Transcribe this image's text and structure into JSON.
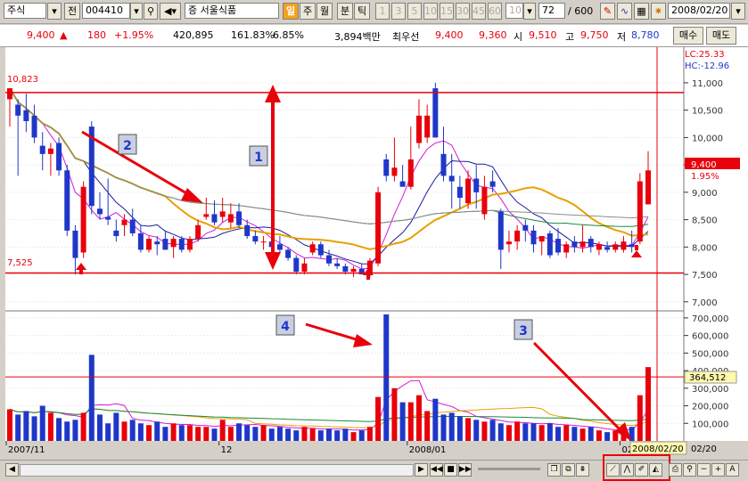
{
  "toolbar": {
    "market": "주식",
    "tab_prev": "전",
    "code": "004410",
    "stock_prefix": "증",
    "stock_name": "서울식품",
    "periods": [
      "일",
      "주",
      "월",
      "분",
      "틱"
    ],
    "minutes": [
      "1",
      "3",
      "5",
      "10",
      "15",
      "30",
      "45",
      "60"
    ],
    "minute_select": "10",
    "count": "72",
    "total": "/ 600",
    "date": "2008/02/20"
  },
  "quote": {
    "price": "9,400",
    "change": "180",
    "change_pct": "+1.95%",
    "volume": "420,895",
    "vol_ratio": "161.83%",
    "turnover": "6.85%",
    "amount": "3,894백만",
    "best_label": "최우선",
    "best_ask": "9,400",
    "best_bid": "9,360",
    "open_label": "시",
    "open": "9,510",
    "high_label": "고",
    "high": "9,750",
    "low_label": "저",
    "low": "8,780",
    "buy_label": "매수",
    "sell_label": "매도"
  },
  "labels": {
    "lc": "LC:25.33",
    "hc": "HC:-12.96",
    "high_line": "10,823",
    "low_line": "7,525",
    "last_price": "9,400",
    "last_pct": "1.95%",
    "vol_current": "364,512",
    "cursor_date": "2008/02/20",
    "x_end": "02/20"
  },
  "annotations": [
    "1",
    "2",
    "3",
    "4"
  ],
  "colors": {
    "up": "#e8000b",
    "down": "#1f37c8",
    "ma5": "#d21adc",
    "ma10": "#1a1aa0",
    "ma20": "#e8a000",
    "ma60": "#1b8a3a",
    "ma120": "#8c8c8c"
  },
  "chart_data": {
    "type": "candlestick",
    "price_axis": {
      "min": 7000,
      "max": 11000,
      "ticks": [
        7000,
        7500,
        8000,
        8500,
        9000,
        9500,
        10000,
        10500,
        11000
      ]
    },
    "volume_axis": {
      "min": 0,
      "max": 700000,
      "ticks": [
        100000,
        200000,
        300000,
        400000,
        500000,
        600000,
        700000
      ]
    },
    "x_ticks": [
      {
        "index": 0,
        "label": "2007/11"
      },
      {
        "index": 26,
        "label": "12"
      },
      {
        "index": 49,
        "label": "2008/01"
      },
      {
        "index": 75,
        "label": "02"
      }
    ],
    "reference_lines": [
      10823,
      7525
    ],
    "volume_reference": 364512,
    "candles": [
      {
        "o": 10700,
        "h": 10900,
        "l": 10200,
        "c": 10900
      },
      {
        "o": 10600,
        "h": 10700,
        "l": 9300,
        "c": 10400
      },
      {
        "o": 10500,
        "h": 10800,
        "l": 10100,
        "c": 10300
      },
      {
        "o": 10400,
        "h": 10600,
        "l": 9900,
        "c": 10000
      },
      {
        "o": 9850,
        "h": 10100,
        "l": 9400,
        "c": 9700
      },
      {
        "o": 9700,
        "h": 9900,
        "l": 9300,
        "c": 9800
      },
      {
        "o": 9900,
        "h": 10000,
        "l": 9300,
        "c": 9400
      },
      {
        "o": 9400,
        "h": 9500,
        "l": 8200,
        "c": 8300
      },
      {
        "o": 8300,
        "h": 8400,
        "l": 7500,
        "c": 7800
      },
      {
        "o": 7900,
        "h": 9200,
        "l": 7800,
        "c": 9100
      },
      {
        "o": 10200,
        "h": 10300,
        "l": 8600,
        "c": 8750
      },
      {
        "o": 8700,
        "h": 9000,
        "l": 8500,
        "c": 8600
      },
      {
        "o": 8550,
        "h": 9250,
        "l": 8400,
        "c": 8500
      },
      {
        "o": 8300,
        "h": 8500,
        "l": 8100,
        "c": 8200
      },
      {
        "o": 8400,
        "h": 8600,
        "l": 8200,
        "c": 8500
      },
      {
        "o": 8500,
        "h": 8700,
        "l": 8200,
        "c": 8250
      },
      {
        "o": 8250,
        "h": 8400,
        "l": 7900,
        "c": 7950
      },
      {
        "o": 7950,
        "h": 8200,
        "l": 7900,
        "c": 8150
      },
      {
        "o": 8100,
        "h": 8200,
        "l": 7850,
        "c": 8050
      },
      {
        "o": 8150,
        "h": 8300,
        "l": 7950,
        "c": 7950
      },
      {
        "o": 8000,
        "h": 8200,
        "l": 7800,
        "c": 8150
      },
      {
        "o": 8150,
        "h": 8200,
        "l": 7900,
        "c": 7950
      },
      {
        "o": 7950,
        "h": 8200,
        "l": 7900,
        "c": 8150
      },
      {
        "o": 8150,
        "h": 8500,
        "l": 8100,
        "c": 8400
      },
      {
        "o": 8550,
        "h": 8900,
        "l": 8500,
        "c": 8600
      },
      {
        "o": 8600,
        "h": 8850,
        "l": 8400,
        "c": 8450
      },
      {
        "o": 8550,
        "h": 8900,
        "l": 8450,
        "c": 8650
      },
      {
        "o": 8450,
        "h": 8800,
        "l": 8350,
        "c": 8600
      },
      {
        "o": 8650,
        "h": 8800,
        "l": 8350,
        "c": 8400
      },
      {
        "o": 8400,
        "h": 8500,
        "l": 8150,
        "c": 8200
      },
      {
        "o": 8200,
        "h": 8300,
        "l": 8050,
        "c": 8100
      },
      {
        "o": 8100,
        "h": 8200,
        "l": 7950,
        "c": 8100
      },
      {
        "o": 8100,
        "h": 8150,
        "l": 7850,
        "c": 8000
      },
      {
        "o": 8050,
        "h": 8200,
        "l": 7900,
        "c": 7950
      },
      {
        "o": 7950,
        "h": 8000,
        "l": 7750,
        "c": 7800
      },
      {
        "o": 7800,
        "h": 7850,
        "l": 7500,
        "c": 7550
      },
      {
        "o": 7550,
        "h": 7800,
        "l": 7500,
        "c": 7700
      },
      {
        "o": 7900,
        "h": 8100,
        "l": 7850,
        "c": 8050
      },
      {
        "o": 8050,
        "h": 8100,
        "l": 7800,
        "c": 7850
      },
      {
        "o": 7850,
        "h": 7950,
        "l": 7650,
        "c": 7700
      },
      {
        "o": 7700,
        "h": 7800,
        "l": 7600,
        "c": 7650
      },
      {
        "o": 7650,
        "h": 7700,
        "l": 7500,
        "c": 7550
      },
      {
        "o": 7550,
        "h": 7650,
        "l": 7450,
        "c": 7600
      },
      {
        "o": 7600,
        "h": 7700,
        "l": 7500,
        "c": 7500
      },
      {
        "o": 7500,
        "h": 7800,
        "l": 7450,
        "c": 7750
      },
      {
        "o": 7700,
        "h": 9100,
        "l": 7650,
        "c": 9000
      },
      {
        "o": 9600,
        "h": 9700,
        "l": 9200,
        "c": 9300
      },
      {
        "o": 9300,
        "h": 10000,
        "l": 9200,
        "c": 9450
      },
      {
        "o": 9200,
        "h": 9500,
        "l": 9150,
        "c": 9100
      },
      {
        "o": 9100,
        "h": 10200,
        "l": 9050,
        "c": 9600
      },
      {
        "o": 9900,
        "h": 10700,
        "l": 9800,
        "c": 10400
      },
      {
        "o": 10000,
        "h": 10600,
        "l": 9900,
        "c": 10400
      },
      {
        "o": 10900,
        "h": 11000,
        "l": 10000,
        "c": 10000
      },
      {
        "o": 9700,
        "h": 10200,
        "l": 9200,
        "c": 9300
      },
      {
        "o": 9300,
        "h": 9700,
        "l": 8700,
        "c": 9200
      },
      {
        "o": 9100,
        "h": 9300,
        "l": 8700,
        "c": 8900
      },
      {
        "o": 8800,
        "h": 9400,
        "l": 8700,
        "c": 9250
      },
      {
        "o": 9250,
        "h": 9500,
        "l": 8700,
        "c": 9000
      },
      {
        "o": 8600,
        "h": 9300,
        "l": 8500,
        "c": 9100
      },
      {
        "o": 9200,
        "h": 9400,
        "l": 9000,
        "c": 9100
      },
      {
        "o": 8650,
        "h": 8700,
        "l": 7600,
        "c": 7950
      },
      {
        "o": 8050,
        "h": 8300,
        "l": 7900,
        "c": 8100
      },
      {
        "o": 8100,
        "h": 8400,
        "l": 7950,
        "c": 8300
      },
      {
        "o": 8400,
        "h": 8500,
        "l": 8100,
        "c": 8300
      },
      {
        "o": 8300,
        "h": 8400,
        "l": 7900,
        "c": 8050
      },
      {
        "o": 8100,
        "h": 8200,
        "l": 7850,
        "c": 8200
      },
      {
        "o": 8250,
        "h": 8300,
        "l": 7800,
        "c": 7850
      },
      {
        "o": 8150,
        "h": 8350,
        "l": 7850,
        "c": 7900
      },
      {
        "o": 7900,
        "h": 8100,
        "l": 7800,
        "c": 8050
      },
      {
        "o": 8100,
        "h": 8200,
        "l": 7900,
        "c": 8000
      },
      {
        "o": 8000,
        "h": 8400,
        "l": 7900,
        "c": 8100
      },
      {
        "o": 8150,
        "h": 8200,
        "l": 7900,
        "c": 8000
      },
      {
        "o": 7950,
        "h": 8100,
        "l": 7850,
        "c": 8050
      },
      {
        "o": 8000,
        "h": 8100,
        "l": 7900,
        "c": 7950
      },
      {
        "o": 7950,
        "h": 8100,
        "l": 7900,
        "c": 8050
      },
      {
        "o": 7950,
        "h": 8200,
        "l": 7900,
        "c": 8100
      },
      {
        "o": 8050,
        "h": 8300,
        "l": 7900,
        "c": 8000
      },
      {
        "o": 8100,
        "h": 9350,
        "l": 8050,
        "c": 9200
      },
      {
        "o": 8780,
        "h": 9750,
        "l": 8780,
        "c": 9400
      }
    ],
    "volume": [
      180000,
      150000,
      170000,
      140000,
      200000,
      160000,
      130000,
      110000,
      120000,
      160000,
      490000,
      150000,
      100000,
      160000,
      110000,
      120000,
      100000,
      90000,
      110000,
      80000,
      100000,
      90000,
      90000,
      80000,
      80000,
      70000,
      120000,
      80000,
      100000,
      90000,
      80000,
      90000,
      70000,
      80000,
      70000,
      60000,
      80000,
      70000,
      60000,
      70000,
      60000,
      70000,
      50000,
      60000,
      80000,
      250000,
      720000,
      300000,
      220000,
      220000,
      260000,
      170000,
      240000,
      150000,
      160000,
      140000,
      130000,
      120000,
      110000,
      120000,
      100000,
      90000,
      110000,
      100000,
      100000,
      90000,
      100000,
      80000,
      90000,
      80000,
      70000,
      80000,
      60000,
      50000,
      60000,
      70000,
      80000,
      260000,
      420000
    ]
  }
}
